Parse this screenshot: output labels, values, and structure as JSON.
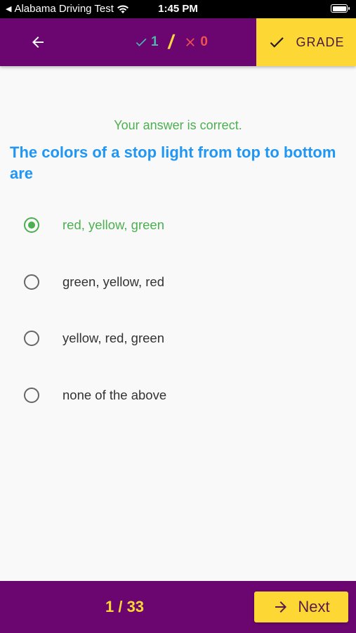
{
  "status_bar": {
    "back_app": "Alabama Driving Test",
    "time": "1:45 PM"
  },
  "app_bar": {
    "correct_count": "1",
    "wrong_count": "0",
    "grade_label": "GRADE"
  },
  "question": {
    "feedback": "Your answer is correct.",
    "text": "The colors of a stop light from top to bottom are",
    "options": [
      {
        "label": "red, yellow, green",
        "selected": true
      },
      {
        "label": "green, yellow, red",
        "selected": false
      },
      {
        "label": "yellow, red, green",
        "selected": false
      },
      {
        "label": "none of the above",
        "selected": false
      }
    ]
  },
  "bottom_bar": {
    "counter": "1 / 33",
    "next_label": "Next"
  },
  "colors": {
    "brand_purple": "#6b0570",
    "accent_yellow": "#fdd835",
    "correct_green": "#4caf50",
    "question_blue": "#2196f3",
    "wrong_red": "#ef5350"
  }
}
